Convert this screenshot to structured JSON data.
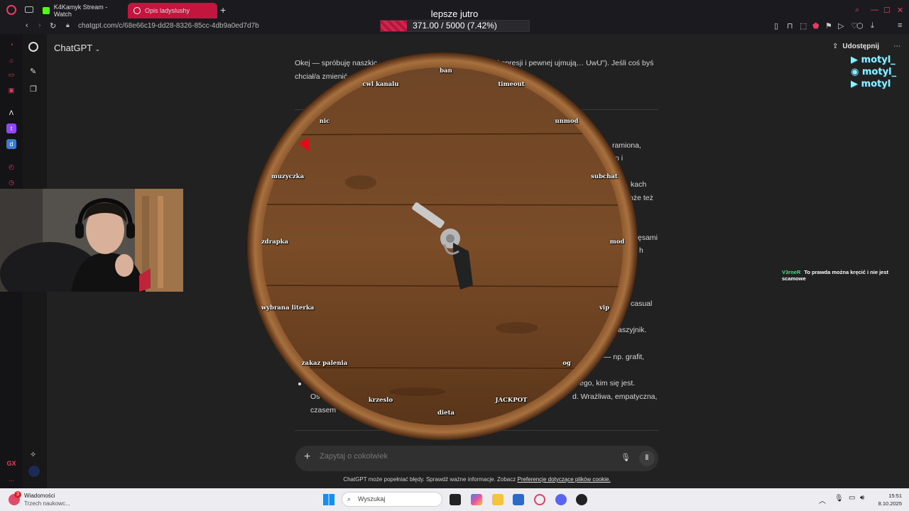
{
  "browser": {
    "tabs": [
      {
        "label": "K4Kamyk Stream - Watch",
        "favicon_color": "#53fc18"
      },
      {
        "label": "Opis ladyslushy",
        "favicon_color": "#ffffff",
        "active": true
      }
    ],
    "url": "chatgpt.com/c/68e66c19-dd28-8326-85cc-4db9a0ed7d7b"
  },
  "stream_goal": {
    "title": "lepsze jutro",
    "progress_text": "371.00 / 5000 (7.42%)",
    "progress_fraction": 0.0742
  },
  "chatgpt": {
    "title": "ChatGPT",
    "share_label": "Udostępnij",
    "paragraph_top": "Okej — spróbuję naszkic… To taka mieszanka delikatności, ekspresji i pewnej ujmują… UwU\"). Jeśli coś byś chciał/a zmienić, popraw…",
    "fragments": [
      "ramiona,",
      "n i",
      "kach",
      "oże też",
      "ęsami",
      "h",
      "casual",
      "aszyjnik.",
      "— np. grafit,",
      "ego, kim się jest.",
      "d. Wrażliwa, empatyczna,",
      "Os",
      "czasem"
    ],
    "composer_placeholder": "Zapytaj o cokolwiek",
    "disclaimer": "ChatGPT może popełniać błędy. Sprawdź ważne informacje. Zobacz",
    "disclaimer_link": "Preferencje dotyczące plików cookie."
  },
  "wheel": {
    "labels": [
      "ban",
      "timeout",
      "unmod",
      "subchat",
      "mod",
      "vip",
      "og",
      "JACKPOT",
      "dieta",
      "krzeslo",
      "zakaz palenia",
      "wybrana literka",
      "zdrapka",
      "muzyczka",
      "nic",
      "cwl kanalu"
    ],
    "pointer_color": "#e30b17",
    "center_icon": "revolver-icon"
  },
  "overlay": {
    "brand_lines": [
      "motyl_",
      "motyl_",
      "motyl"
    ],
    "chat_user": "V3rneR",
    "chat_text": "To prawda można kręcić i nie jest scamowe"
  },
  "taskbar": {
    "notif_title": "Wiadomości",
    "notif_sub": "Trzech naukowc...",
    "notif_badge": "3",
    "search_placeholder": "Wyszukaj",
    "time": "15:51",
    "date": "8.10.2025"
  },
  "side_extras": {
    "opera_label": "GX"
  }
}
